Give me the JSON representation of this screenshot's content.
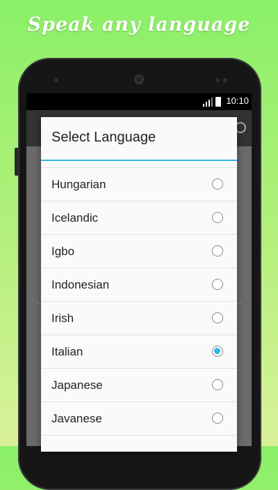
{
  "banner": {
    "tagline": "Speak any language"
  },
  "status_bar": {
    "time": "10:10"
  },
  "dialog": {
    "title": "Select Language",
    "accent_color": "#33b5e5",
    "options": [
      {
        "label": "Hungarian",
        "selected": false
      },
      {
        "label": "Icelandic",
        "selected": false
      },
      {
        "label": "Igbo",
        "selected": false
      },
      {
        "label": "Indonesian",
        "selected": false
      },
      {
        "label": "Irish",
        "selected": false
      },
      {
        "label": "Italian",
        "selected": true
      },
      {
        "label": "Japanese",
        "selected": false
      },
      {
        "label": "Javanese",
        "selected": false
      },
      {
        "label": "",
        "selected": false
      }
    ]
  }
}
